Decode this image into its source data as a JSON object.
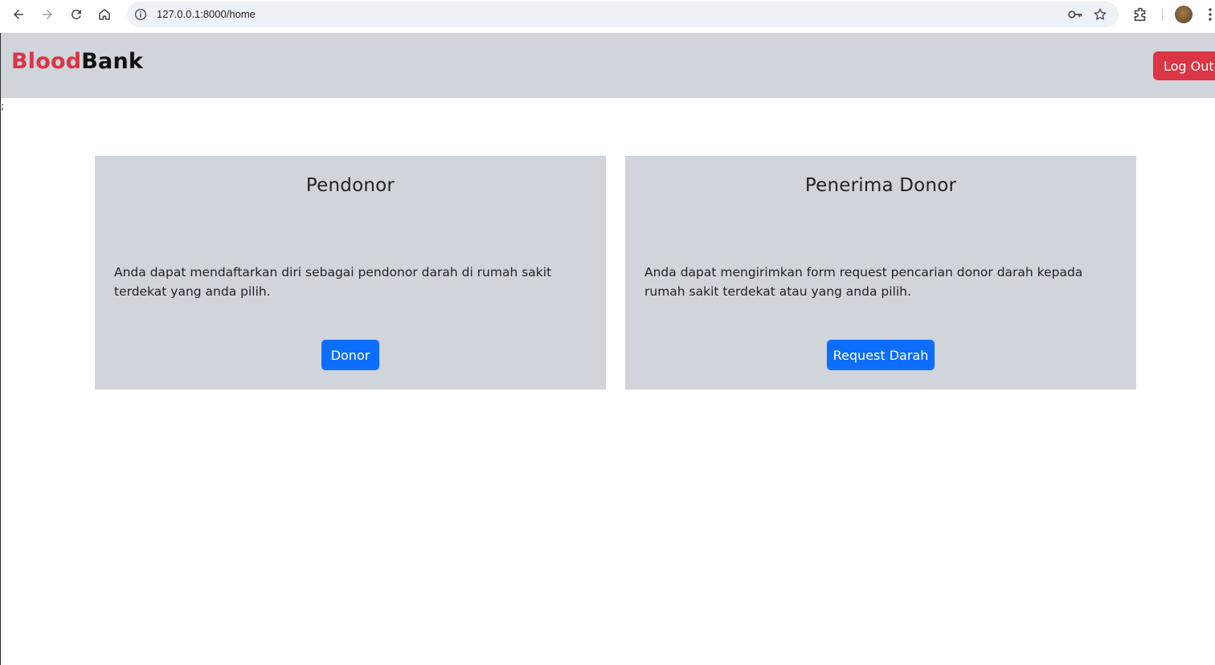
{
  "browser": {
    "url": "127.0.0.1:8000/home"
  },
  "navbar": {
    "brand_part1": "Blood",
    "brand_part2": "Bank",
    "logout_label": "Log Out",
    "accent_color": "#dc3545"
  },
  "stray_text": ";",
  "cards": [
    {
      "title": "Pendonor",
      "description": "Anda dapat mendaftarkan diri sebagai pendonor darah di rumah sakit terdekat yang anda pilih.",
      "button_label": "Donor"
    },
    {
      "title": "Penerima Donor",
      "description": "Anda dapat mengirimkan form request pencarian donor darah kepada rumah sakit terdekat atau yang anda pilih.",
      "button_label": "Request Darah"
    }
  ],
  "colors": {
    "primary_button": "#0d6efd",
    "card_background": "#d0d4db"
  }
}
